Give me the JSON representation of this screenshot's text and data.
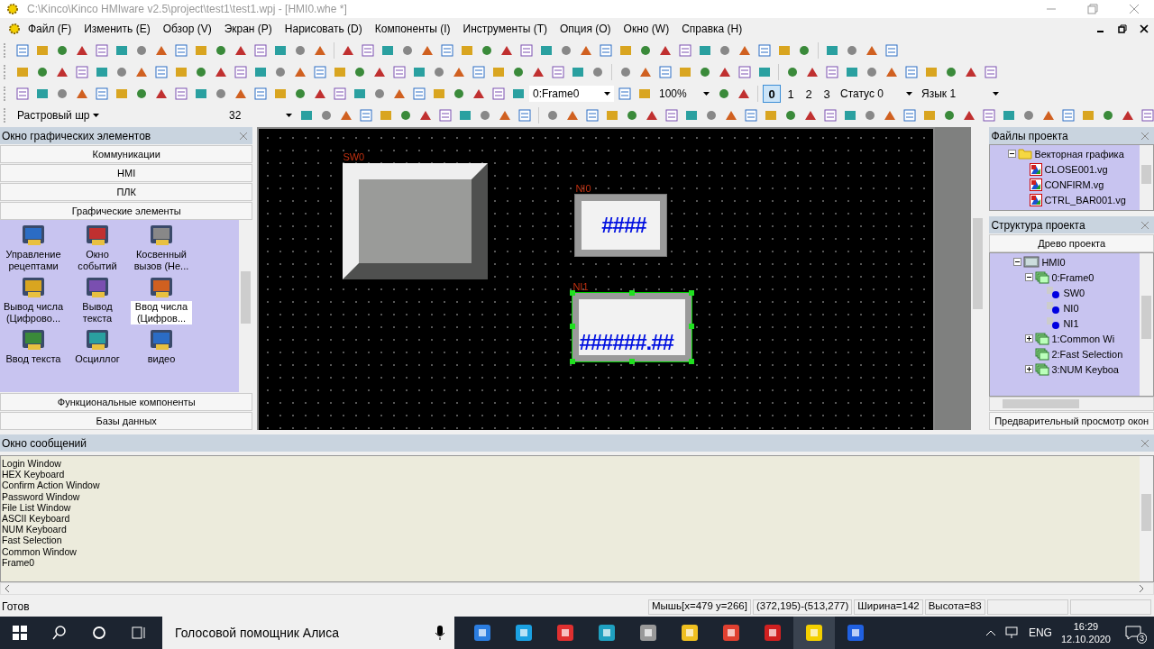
{
  "window": {
    "title": "C:\\Kinco\\Kinco HMIware v2.5\\project\\test1\\test1.wpj - [HMI0.whe *]"
  },
  "menu": [
    "Файл (F)",
    "Изменить (E)",
    "Обзор (V)",
    "Экран (P)",
    "Нарисовать (D)",
    "Компоненты (I)",
    "Инструменты (T)",
    "Опция (O)",
    "Окно (W)",
    "Справка (H)"
  ],
  "toolbar": {
    "frame": "0:Frame0",
    "zoom": "100%",
    "states": [
      {
        "label": "0",
        "selected": true
      },
      {
        "label": "1",
        "selected": false
      },
      {
        "label": "2",
        "selected": false
      },
      {
        "label": "3",
        "selected": false
      }
    ],
    "status": "Статус 0",
    "language": "Язык 1",
    "font_name": "Растровый шр",
    "font_size": "32"
  },
  "left_panel": {
    "title": "Окно графических элементов",
    "sections_top": [
      "Коммуникации",
      "HMI",
      "ПЛК",
      "Графические элементы"
    ],
    "items": [
      {
        "label": "Управление рецептами",
        "selected": false
      },
      {
        "label": "Окно событий",
        "selected": false
      },
      {
        "label": "Косвенный вызов (Не...",
        "selected": false
      },
      {
        "label": "Вывод числа (Цифрово...",
        "selected": false
      },
      {
        "label": "Вывод текста",
        "selected": false
      },
      {
        "label": "Ввод числа (Цифров...",
        "selected": true
      },
      {
        "label": "Ввод текста",
        "selected": false
      },
      {
        "label": "Осциллог",
        "selected": false
      },
      {
        "label": "видео",
        "selected": false
      }
    ],
    "sections_bottom": [
      "Функциональные компоненты",
      "Базы данных"
    ]
  },
  "canvas": {
    "objects": [
      {
        "kind": "switch",
        "label": "SW0",
        "selected": false
      },
      {
        "kind": "numeric",
        "label": "NI0",
        "value": "####",
        "selected": false
      },
      {
        "kind": "numeric",
        "label": "NI1",
        "value": "######.##",
        "selected": true
      }
    ]
  },
  "files_panel": {
    "title": "Файлы проекта",
    "tree": [
      {
        "label": "Векторная графика",
        "kind": "folder",
        "expanded": true,
        "children": [
          {
            "label": "CLOSE001.vg",
            "kind": "file"
          },
          {
            "label": "CONFIRM.vg",
            "kind": "file"
          },
          {
            "label": "CTRL_BAR001.vg",
            "kind": "file"
          }
        ]
      }
    ]
  },
  "structure_panel": {
    "title": "Структура проекта",
    "tab": "Древо проекта",
    "tree": [
      {
        "label": "HMI0",
        "kind": "hmi",
        "expanded": true,
        "children": [
          {
            "label": "0:Frame0",
            "kind": "frame",
            "expanded": true,
            "children": [
              {
                "label": "SW0",
                "kind": "object"
              },
              {
                "label": "NI0",
                "kind": "object"
              },
              {
                "label": "NI1",
                "kind": "object"
              }
            ]
          },
          {
            "label": "1:Common Wi",
            "kind": "frame",
            "expanded": false
          },
          {
            "label": "2:Fast Selection",
            "kind": "frame"
          },
          {
            "label": "3:NUM Keyboa",
            "kind": "frame",
            "expanded": false
          }
        ]
      }
    ],
    "footer": "Предварительный просмотр окон"
  },
  "messages": {
    "title": "Окно сообщений",
    "lines": [
      "Login Window",
      "HEX Keyboard",
      "Confirm Action Window",
      "Password Window",
      "File List Window",
      "ASCII Keyboard",
      "NUM Keyboard",
      "Fast Selection",
      "Common Window",
      "Frame0"
    ]
  },
  "status_bar": {
    "text": "Готов",
    "fields": [
      "Мышь[x=479  y=266]",
      "(372,195)-(513,277)",
      "Ширина=142",
      "Высота=83"
    ]
  },
  "taskbar": {
    "search": "Голосовой помощник Алиса",
    "language": "ENG",
    "time": "16:29",
    "date": "12.10.2020",
    "notifications": "3"
  }
}
